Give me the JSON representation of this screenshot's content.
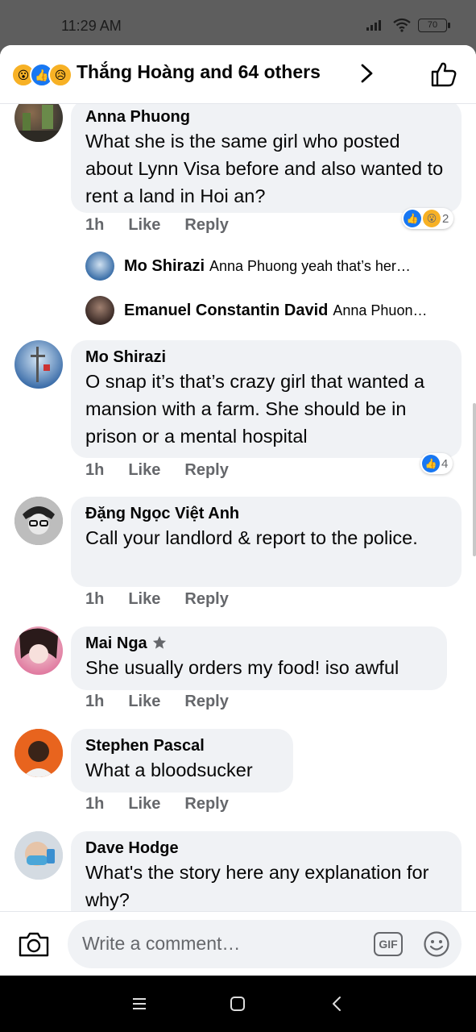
{
  "status_bar": {
    "time": "11:29 AM",
    "battery": "70"
  },
  "header": {
    "title": "Thắng Hoàng and 64 others"
  },
  "comments": [
    {
      "author": "Anna Phuong",
      "text": "What she is the same girl who posted about Lynn Visa before and also wanted to rent a land in Hoi an?",
      "time": "1h",
      "like": "Like",
      "reply": "Reply",
      "reaction_count": "2"
    },
    {
      "author": "Mo Shirazi",
      "text": "O snap it’s that’s crazy girl that wanted a mansion with a farm. She should be in prison or a mental hospital",
      "time": "1h",
      "like": "Like",
      "reply": "Reply",
      "reaction_count": "4"
    },
    {
      "author": "Đặng Ngọc Việt Anh",
      "text": "Call your landlord & report to the police.",
      "time": "1h",
      "like": "Like",
      "reply": "Reply"
    },
    {
      "author": "Mai Nga",
      "text": "She usually orders my food! iso awful",
      "time": "1h",
      "like": "Like",
      "reply": "Reply"
    },
    {
      "author": "Stephen Pascal",
      "text": "What a bloodsucker",
      "time": "1h",
      "like": "Like",
      "reply": "Reply"
    },
    {
      "author": "Dave Hodge",
      "text": "What's the story here any explanation for why?"
    }
  ],
  "replies": [
    {
      "author": "Mo Shirazi",
      "text": "Anna Phuong yeah that’s her…"
    },
    {
      "author": "Emanuel Constantin David",
      "text": "Anna Phuon…"
    }
  ],
  "composer": {
    "placeholder": "Write a comment…",
    "gif": "GIF"
  }
}
